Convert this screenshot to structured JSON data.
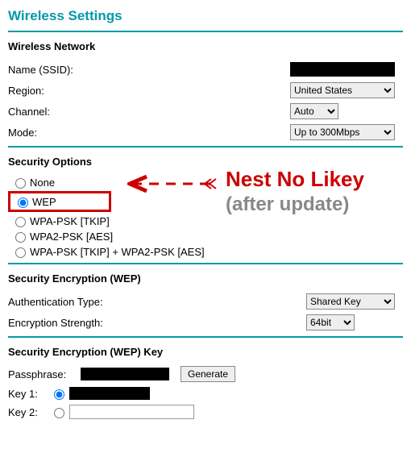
{
  "page_title": "Wireless Settings",
  "sections": {
    "network": {
      "title": "Wireless Network",
      "name_label": "Name (SSID):",
      "region_label": "Region:",
      "region_value": "United States",
      "channel_label": "Channel:",
      "channel_value": "Auto",
      "mode_label": "Mode:",
      "mode_value": "Up to 300Mbps"
    },
    "security": {
      "title": "Security Options",
      "options": {
        "none": "None",
        "wep": "WEP",
        "wpa_tkip": "WPA-PSK [TKIP]",
        "wpa2_aes": "WPA2-PSK [AES]",
        "wpa_mixed": "WPA-PSK [TKIP] + WPA2-PSK [AES]"
      }
    },
    "wep_enc": {
      "title": "Security Encryption (WEP)",
      "auth_label": "Authentication Type:",
      "auth_value": "Shared Key",
      "strength_label": "Encryption Strength:",
      "strength_value": "64bit"
    },
    "wep_key": {
      "title": "Security Encryption (WEP) Key",
      "passphrase_label": "Passphrase:",
      "generate_label": "Generate",
      "key1_label": "Key 1:",
      "key2_label": "Key 2:"
    }
  },
  "annotation": {
    "line1": "Nest No Likey",
    "line2": "(after update)"
  }
}
